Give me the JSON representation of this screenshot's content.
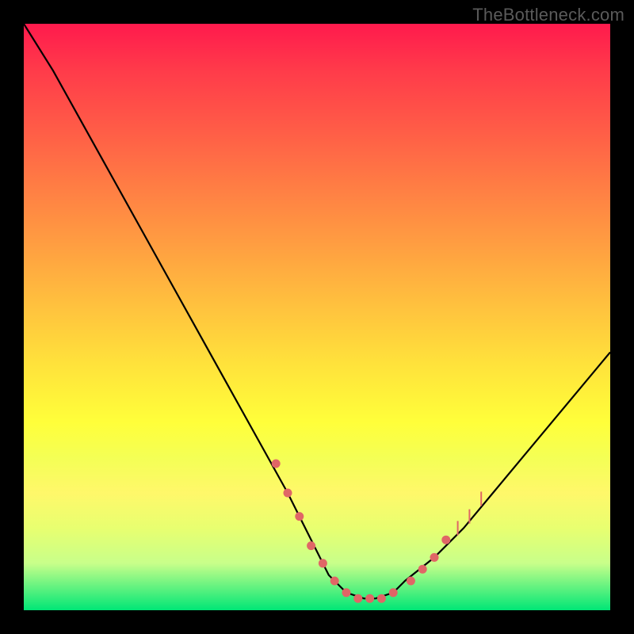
{
  "watermark": "TheBottleneck.com",
  "colors": {
    "frame": "#000000",
    "curve": "#000000",
    "marker": "#e06666",
    "gradient_top": "#ff1a4d",
    "gradient_bottom": "#00e676"
  },
  "chart_data": {
    "type": "line",
    "title": "",
    "xlabel": "",
    "ylabel": "",
    "xlim": [
      0,
      100
    ],
    "ylim": [
      0,
      100
    ],
    "x": [
      0,
      5,
      10,
      15,
      20,
      25,
      30,
      35,
      40,
      45,
      48,
      50,
      52,
      55,
      58,
      60,
      63,
      65,
      70,
      75,
      80,
      85,
      90,
      95,
      100
    ],
    "values": [
      100,
      92,
      83,
      74,
      65,
      56,
      47,
      38,
      29,
      20,
      14,
      10,
      6,
      3,
      2,
      2,
      3,
      5,
      9,
      14,
      20,
      26,
      32,
      38,
      44
    ],
    "markers_x": [
      43,
      45,
      47,
      49,
      51,
      53,
      55,
      57,
      59,
      61,
      63,
      66,
      68,
      70,
      72,
      74,
      76,
      78
    ],
    "markers_y": [
      25,
      20,
      16,
      11,
      8,
      5,
      3,
      2,
      2,
      2,
      3,
      5,
      7,
      9,
      12,
      14,
      16,
      19
    ]
  }
}
